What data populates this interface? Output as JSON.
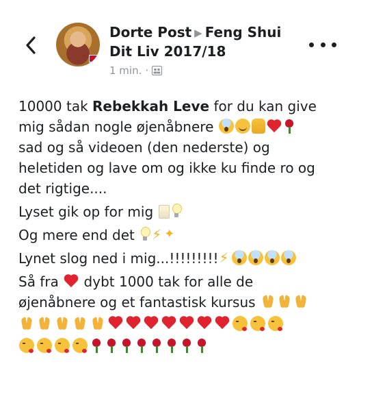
{
  "header": {
    "back_icon": "chevron-left-icon",
    "author": "Dorte Post",
    "separator_icon": "right-triangle-icon",
    "group": "Feng Shui Dit Liv 2017/18",
    "group_line1": "Feng Shui",
    "group_line2": "Dit Liv 2017/18",
    "timestamp": "1 min.",
    "dot": "·",
    "audience_icon": "group-icon",
    "more_icon": "more-horizontal-icon"
  },
  "post": {
    "line1_prefix": "10000 tak ",
    "line1_bold": "Rebekkah Leve",
    "line1_suffix": " for du kan give",
    "line2": "mig sådan nogle øjenåbnere",
    "line3": "sad og så videoen (den nederste) og",
    "line4": "heletiden og lave om og ikke ku finde ro og",
    "line5": "det rigtige....",
    "line6": "Lyset gik op for mig",
    "line7": "Og mere end det",
    "line8": "Lynet slog ned i mig...!!!!!!!!!",
    "line9_prefix": "Så fra",
    "line9_suffix": "dybt 1000 tak for alle de",
    "line10": "øjenåbnere og et fantastisk kursus"
  },
  "emoji": {
    "line2": [
      "scream",
      "smile",
      "thumb",
      "heart",
      "rose"
    ],
    "line6": [
      "candle",
      "bulb"
    ],
    "line7": [
      "bulb",
      "bolt",
      "dizzy"
    ],
    "line8": [
      "bolt",
      "scream",
      "scream",
      "scream",
      "scream"
    ],
    "line9": [
      "heart"
    ],
    "line10": [
      "pray",
      "pray",
      "pray"
    ],
    "row1": [
      "pray",
      "pray",
      "pray",
      "pray",
      "pray",
      "heart",
      "heart",
      "heart",
      "heart",
      "heart",
      "heart",
      "heart",
      "kiss",
      "kiss",
      "kiss"
    ],
    "row2": [
      "kiss",
      "kiss",
      "kiss",
      "kiss",
      "rose",
      "rose",
      "rose",
      "rose",
      "rose",
      "rose",
      "rose",
      "rose"
    ]
  },
  "colors": {
    "text": "#1c1e21",
    "secondary": "#90949c"
  }
}
